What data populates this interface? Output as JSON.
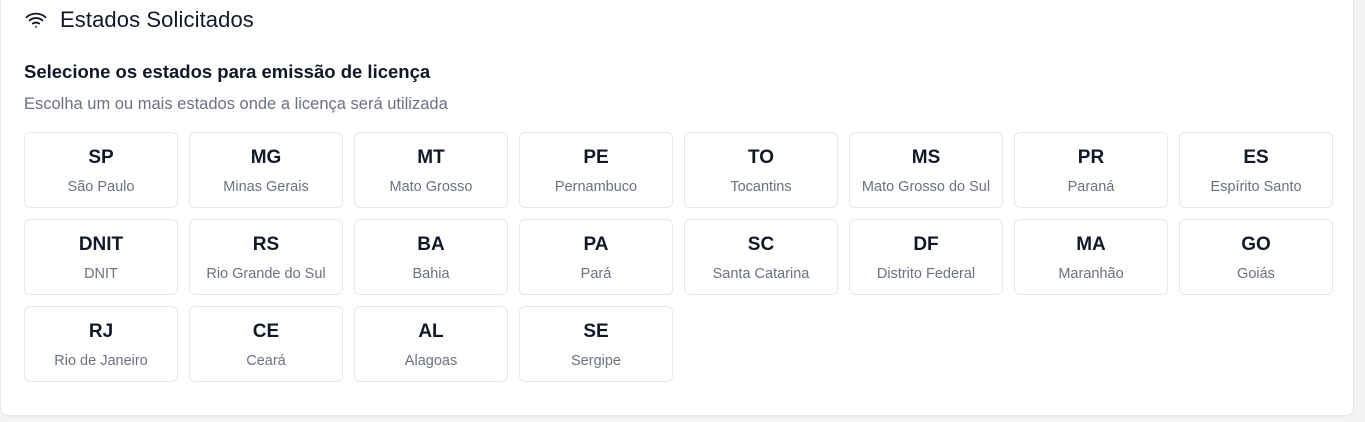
{
  "header": {
    "icon": "wifi-icon",
    "title": "Estados Solicitados"
  },
  "section": {
    "title": "Selecione os estados para emissão de licença",
    "subtitle": "Escolha um ou mais estados onde a licença será utilizada"
  },
  "states": [
    {
      "code": "SP",
      "name": "São Paulo"
    },
    {
      "code": "MG",
      "name": "Minas Gerais"
    },
    {
      "code": "MT",
      "name": "Mato Grosso"
    },
    {
      "code": "PE",
      "name": "Pernambuco"
    },
    {
      "code": "TO",
      "name": "Tocantins"
    },
    {
      "code": "MS",
      "name": "Mato Grosso do Sul"
    },
    {
      "code": "PR",
      "name": "Paraná"
    },
    {
      "code": "ES",
      "name": "Espírito Santo"
    },
    {
      "code": "DNIT",
      "name": "DNIT"
    },
    {
      "code": "RS",
      "name": "Rio Grande do Sul"
    },
    {
      "code": "BA",
      "name": "Bahia"
    },
    {
      "code": "PA",
      "name": "Pará"
    },
    {
      "code": "SC",
      "name": "Santa Catarina"
    },
    {
      "code": "DF",
      "name": "Distrito Federal"
    },
    {
      "code": "MA",
      "name": "Maranhão"
    },
    {
      "code": "GO",
      "name": "Goiás"
    },
    {
      "code": "RJ",
      "name": "Rio de Janeiro"
    },
    {
      "code": "CE",
      "name": "Ceará"
    },
    {
      "code": "AL",
      "name": "Alagoas"
    },
    {
      "code": "SE",
      "name": "Sergipe"
    }
  ]
}
